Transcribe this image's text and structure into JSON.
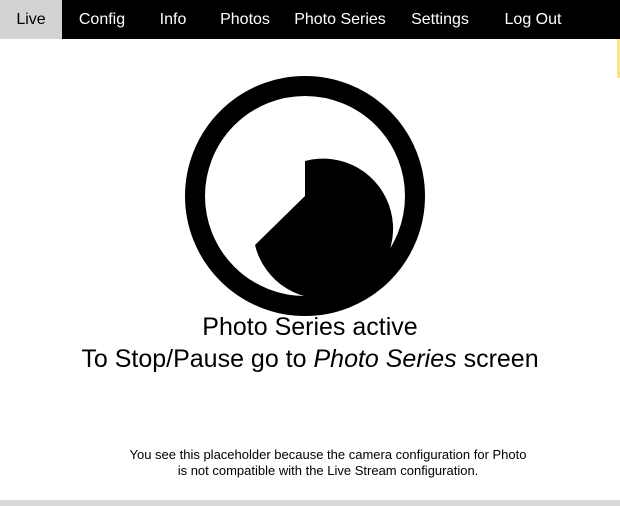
{
  "nav": {
    "items": [
      {
        "label": "Live",
        "active": true
      },
      {
        "label": "Config",
        "active": false
      },
      {
        "label": "Info",
        "active": false
      },
      {
        "label": "Photos",
        "active": false
      },
      {
        "label": "Photo Series",
        "active": false
      },
      {
        "label": "Settings",
        "active": false
      },
      {
        "label": "Log Out",
        "active": false
      }
    ]
  },
  "placeholder": {
    "icon": "timer-icon",
    "status_title": "Photo Series active",
    "instruction_prefix": "To Stop/Pause go to ",
    "instruction_link": "Photo Series",
    "instruction_suffix": " screen",
    "note_line1": "You see this placeholder because the camera configuration for Photo",
    "note_line2": "is not compatible with the Live Stream configuration."
  },
  "colors": {
    "navbar_bg": "#000000",
    "nav_active_bg": "#d3d3d3",
    "text": "#000000"
  }
}
